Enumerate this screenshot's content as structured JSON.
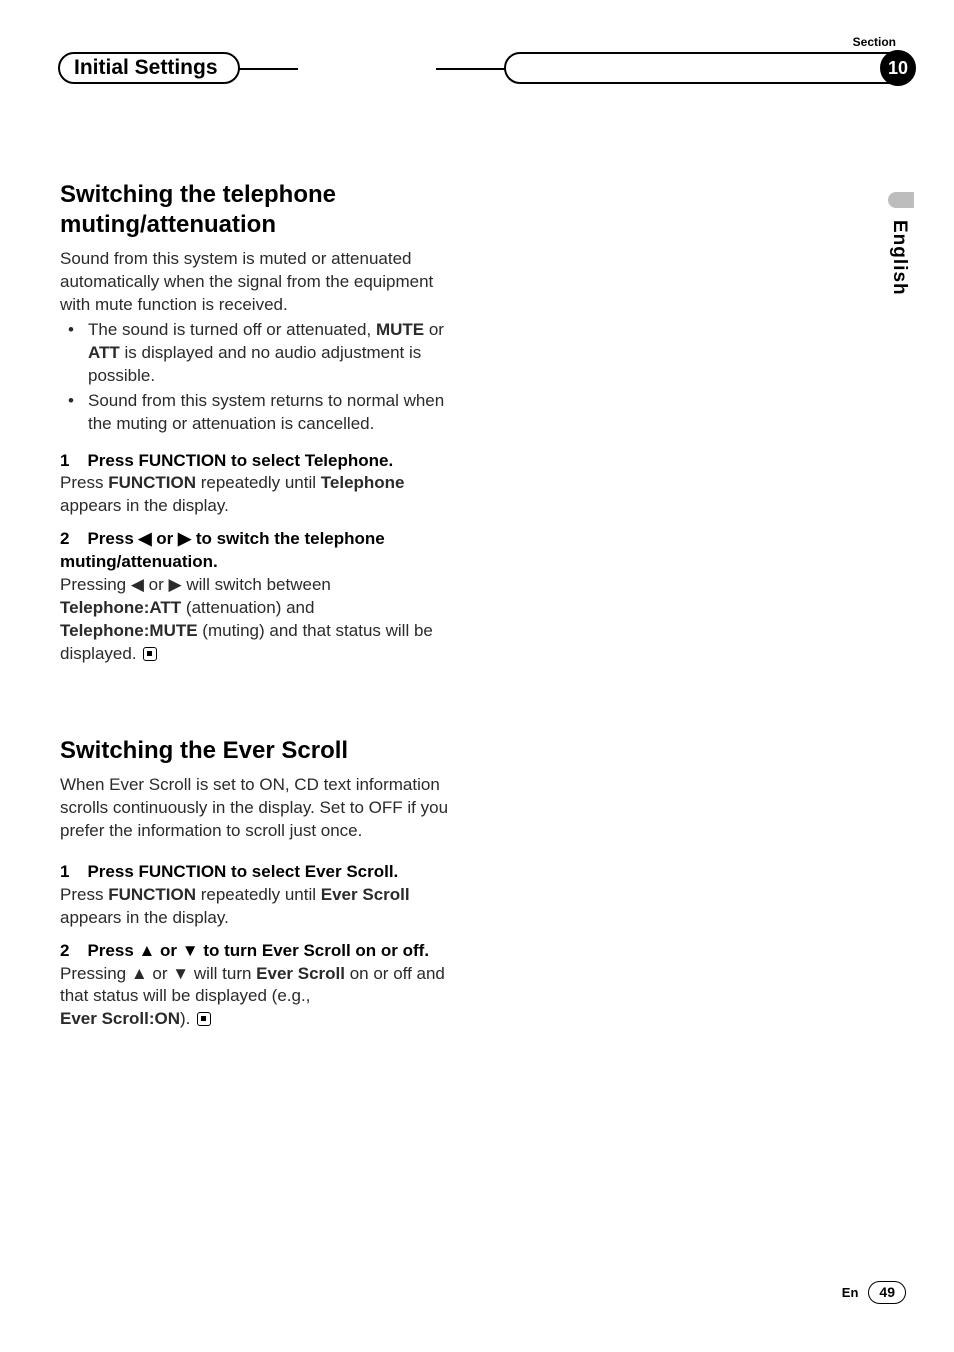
{
  "header": {
    "title": "Initial Settings",
    "section_label": "Section",
    "section_number": "10"
  },
  "side_tab": {
    "language": "English"
  },
  "section1": {
    "heading": "Switching the telephone muting/attenuation",
    "intro": "Sound from this system is muted or attenuated automatically when the signal from the equipment with mute function is received.",
    "bullets": [
      {
        "pre": "The sound is turned off or attenuated, ",
        "b1": "MUTE",
        "mid1": " or ",
        "b2": "ATT",
        "post": " is displayed and no audio adjustment is possible."
      },
      {
        "text": "Sound from this system returns to normal when the muting or attenuation is cancelled."
      }
    ],
    "step1": {
      "num": "1",
      "title": "Press FUNCTION to select Telephone.",
      "body_pre": "Press ",
      "body_b1": "FUNCTION",
      "body_mid": " repeatedly until ",
      "body_b2": "Telephone",
      "body_post": " appears in the display."
    },
    "step2": {
      "num": "2",
      "title_pre": "Press ",
      "title_left": "◀",
      "title_or": " or ",
      "title_right": "▶",
      "title_post": " to switch the telephone muting/attenuation.",
      "l1_pre": "Pressing ",
      "l1_left": "◀",
      "l1_or": " or ",
      "l1_right": "▶",
      "l1_post": " will switch between",
      "l2_b": "Telephone:ATT",
      "l2_post": " (attenuation) and",
      "l3_b": "Telephone:MUTE",
      "l3_post": " (muting) and that status will be displayed."
    }
  },
  "section2": {
    "heading": "Switching the Ever Scroll",
    "intro": "When Ever Scroll is set to ON, CD text information scrolls continuously in the display. Set to OFF if you prefer the information to scroll just once.",
    "step1": {
      "num": "1",
      "title": "Press FUNCTION to select Ever Scroll.",
      "body_pre": "Press ",
      "body_b1": "FUNCTION",
      "body_mid": " repeatedly until ",
      "body_b2": "Ever Scroll",
      "body_post": " appears in the display."
    },
    "step2": {
      "num": "2",
      "title_pre": "Press ",
      "title_up": "▲",
      "title_or": " or ",
      "title_down": "▼",
      "title_post": " to turn Ever Scroll on or off.",
      "l1_pre": "Pressing ",
      "l1_up": "▲",
      "l1_or": " or ",
      "l1_down": "▼",
      "l1_mid": " will turn ",
      "l1_b": "Ever Scroll",
      "l1_post": " on or off and that status will be displayed (e.g.,",
      "l2_b": "Ever Scroll:ON",
      "l2_post": ")."
    }
  },
  "footer": {
    "lang": "En",
    "page": "49"
  }
}
